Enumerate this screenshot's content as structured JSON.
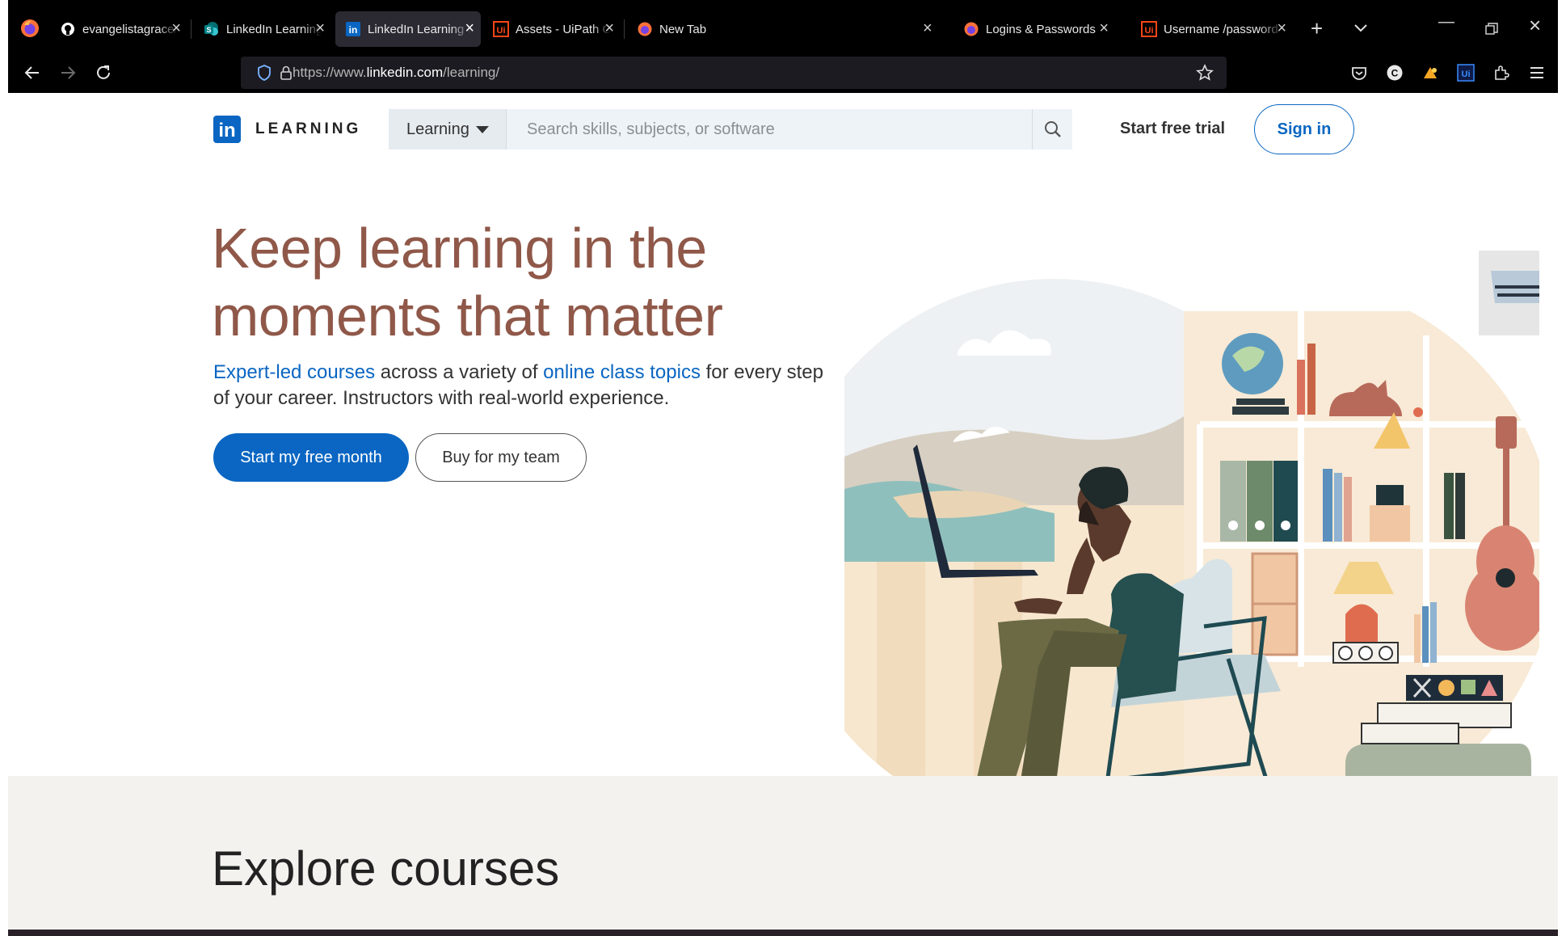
{
  "browser": {
    "tabs": [
      {
        "title": "evangelistagrace/lltr",
        "favicon": "github-icon"
      },
      {
        "title": "LinkedIn Learning Tra",
        "favicon": "sharepoint-icon"
      },
      {
        "title": "LinkedIn Learning with",
        "favicon": "linkedin-icon",
        "active": true
      },
      {
        "title": "Assets - UiPath Orches",
        "favicon": "uipath-icon"
      },
      {
        "title": "New Tab",
        "favicon": "firefox-icon"
      },
      {
        "title": "Logins & Passwords",
        "favicon": "firefox-icon"
      },
      {
        "title": "Username /password",
        "favicon": "uipath-icon"
      }
    ],
    "url_prefix": "https://www.",
    "url_domain": "linkedin.com",
    "url_path": "/learning/"
  },
  "header": {
    "logo_word": "LEARNING",
    "search_category": "Learning",
    "search_placeholder": "Search skills, subjects, or software",
    "trial_label": "Start free trial",
    "signin_label": "Sign in"
  },
  "hero": {
    "title_line1": "Keep learning in the",
    "title_line2": "moments that matter",
    "sub_link1": "Expert-led courses",
    "sub_text1": " across a variety of ",
    "sub_link2": "online class topics",
    "sub_text2": " for every step of your career. Instructors with real-world experience.",
    "primary_cta": "Start my free month",
    "secondary_cta": "Buy for my team"
  },
  "explore": {
    "title": "Explore courses"
  },
  "colors": {
    "brand": "#0a66c2",
    "headline": "#8f5849"
  }
}
